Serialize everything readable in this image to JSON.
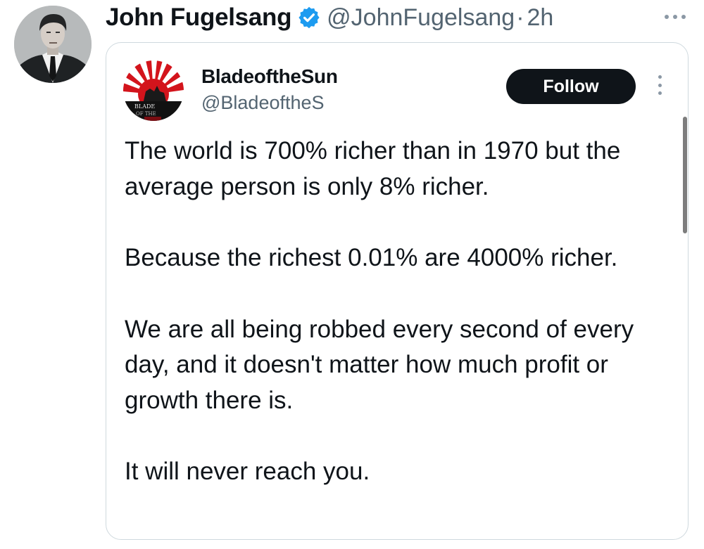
{
  "tweet": {
    "author_name": "John Fugelsang",
    "author_handle": "@JohnFugelsang",
    "separator": "·",
    "timestamp": "2h",
    "verified_icon": "verified-badge-icon",
    "more_icon": "more-horizontal-icon"
  },
  "quoted": {
    "name": "BladeoftheSun",
    "handle": "@BladeoftheS",
    "follow_label": "Follow",
    "avatar_text_line1": "BLADE",
    "avatar_text_line2": "OF THE",
    "paragraphs": [
      "The world is 700% richer than in 1970 but the average person is only 8% richer.",
      "Because the richest 0.01% are 4000% richer.",
      "We are all being robbed every second of every day, and it doesn't matter how much profit or growth there is.",
      "It will never reach you."
    ]
  },
  "colors": {
    "text": "#0f1419",
    "secondary": "#536471",
    "verified": "#1d9bf0",
    "border": "#cfd9de",
    "follow_bg": "#0f1419"
  }
}
